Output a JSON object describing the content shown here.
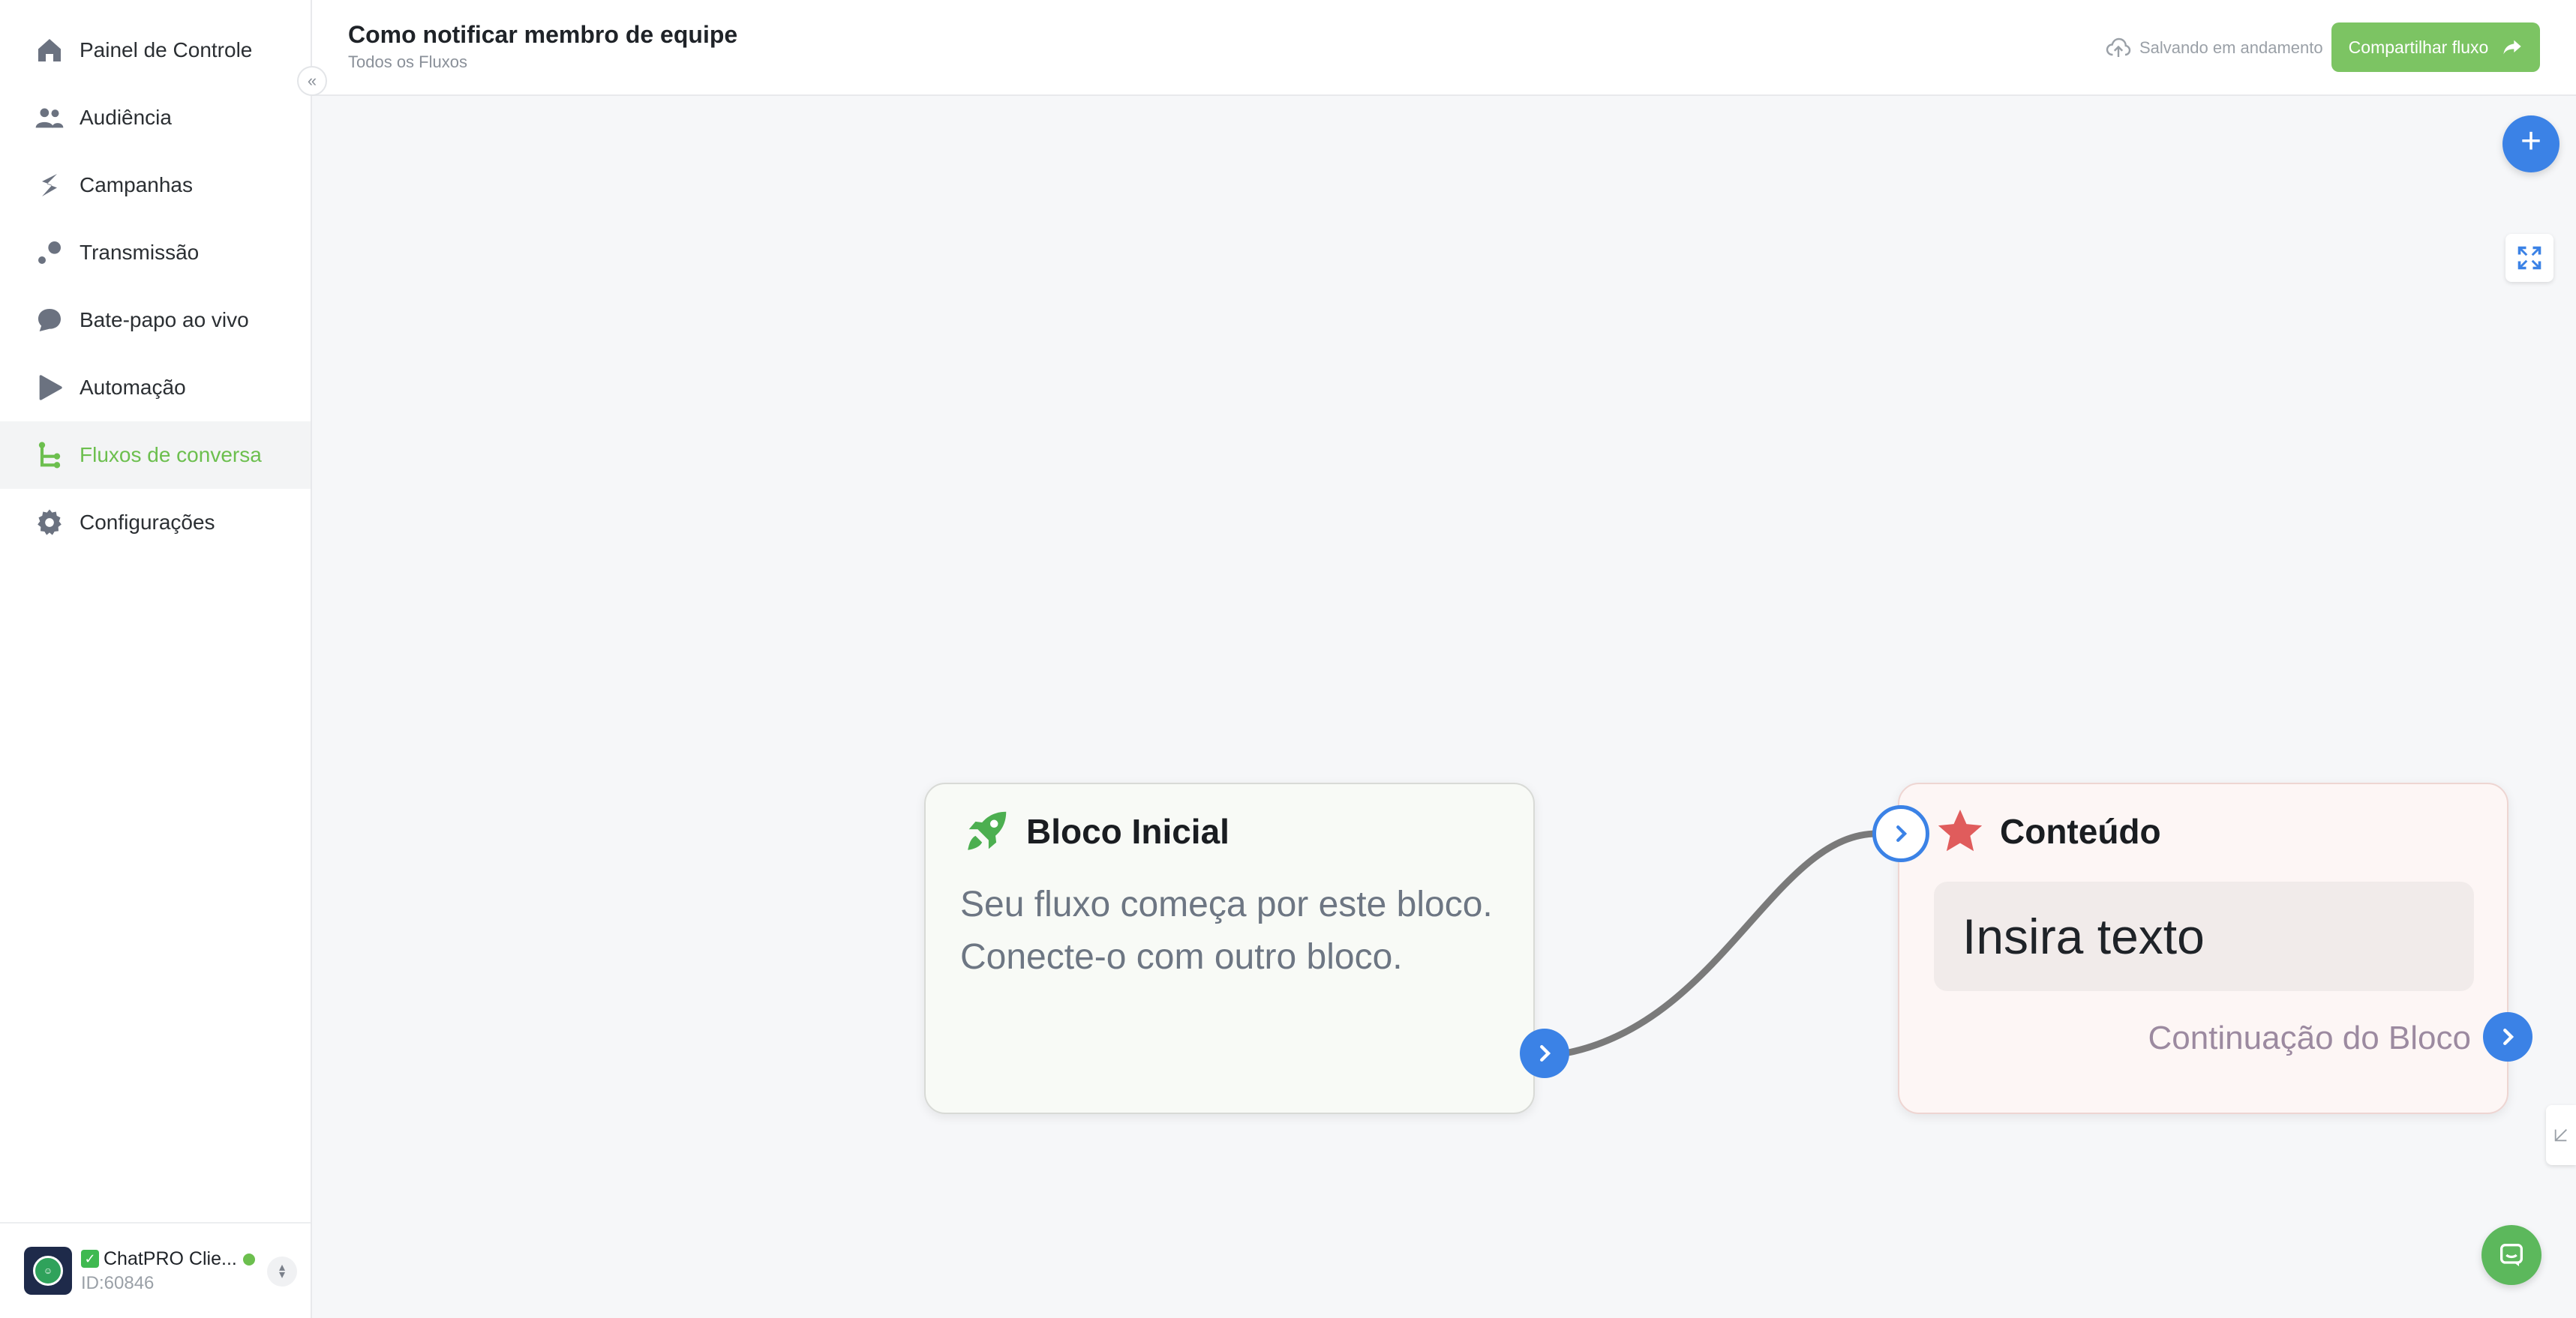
{
  "sidebar": {
    "items": [
      {
        "label": "Painel de Controle",
        "icon": "home-icon"
      },
      {
        "label": "Audiência",
        "icon": "users-icon"
      },
      {
        "label": "Campanhas",
        "icon": "campaign-icon"
      },
      {
        "label": "Transmissão",
        "icon": "broadcast-icon"
      },
      {
        "label": "Bate-papo ao vivo",
        "icon": "chat-bubble-icon"
      },
      {
        "label": "Automação",
        "icon": "automation-icon"
      },
      {
        "label": "Fluxos de conversa",
        "icon": "flow-icon",
        "active": true
      },
      {
        "label": "Configurações",
        "icon": "gear-icon"
      }
    ],
    "account": {
      "name": "ChatPRO Clie...",
      "id": "ID:60846",
      "status": "online"
    }
  },
  "header": {
    "title": "Como notificar membro de equipe",
    "breadcrumb": "Todos os Fluxos",
    "save_status": "Salvando em andamento",
    "share_label": "Compartilhar fluxo"
  },
  "canvas": {
    "start_block": {
      "title": "Bloco Inicial",
      "description": "Seu fluxo começa por este bloco. Conecte-o com outro bloco.",
      "icon": "rocket-icon"
    },
    "content_block": {
      "title": "Conteúdo",
      "text": "Insira texto",
      "continue_label": "Continuação do Bloco",
      "icon": "star-icon"
    }
  },
  "colors": {
    "accent_green": "#6cbf4e",
    "share_button": "#7cc463",
    "primary_blue": "#3b82e6",
    "star_red": "#e05c5c",
    "connector": "#7a7a7a"
  }
}
